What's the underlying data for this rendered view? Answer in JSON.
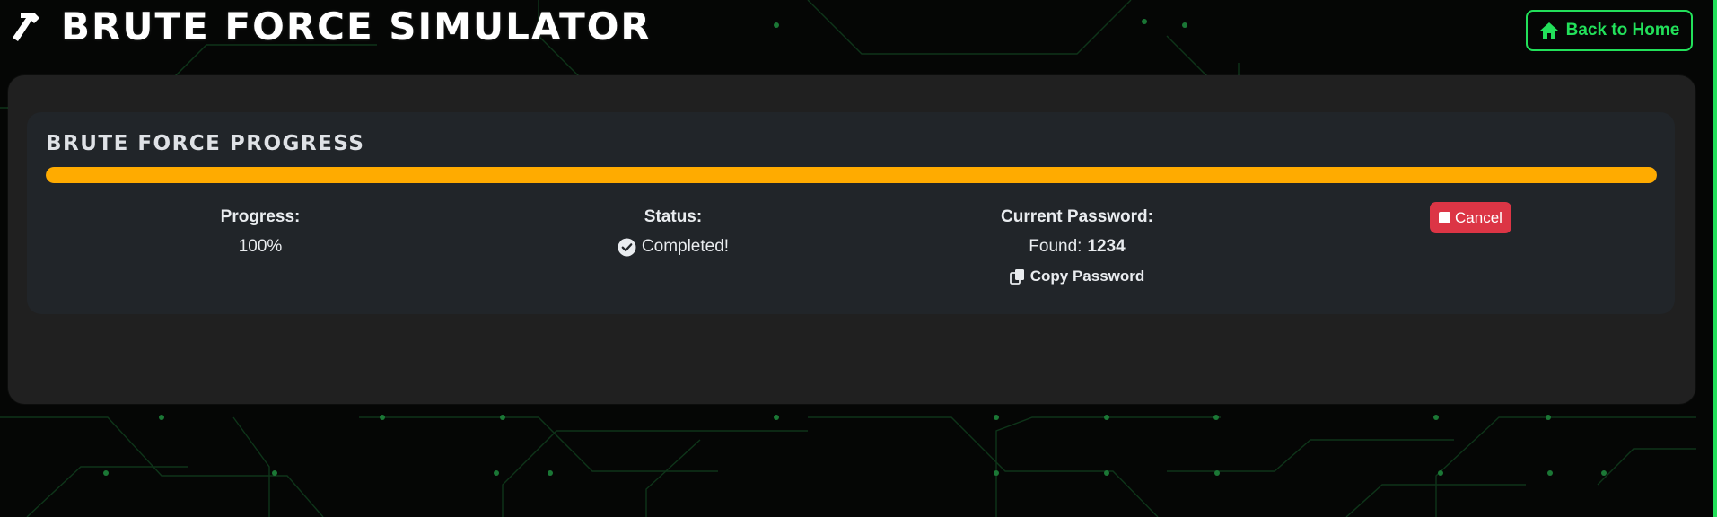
{
  "header": {
    "title": "BRUTE FORCE SIMULATOR",
    "logo_icon": "hammer-icon",
    "home_button": {
      "label": "Back to Home",
      "icon": "home-icon"
    }
  },
  "panel": {
    "title": "BRUTE FORCE PROGRESS",
    "progress": {
      "fraction": 1.0,
      "label": "Progress:",
      "value": "100%"
    },
    "status": {
      "label": "Status:",
      "icon": "check-circle-icon",
      "value": "Completed!"
    },
    "current_password": {
      "label": "Current Password:",
      "found_prefix": "Found:",
      "found_value": "1234",
      "copy_label": "Copy Password",
      "copy_icon": "copy-icon"
    },
    "cancel": {
      "label": "Cancel",
      "icon": "stop-icon"
    }
  },
  "colors": {
    "accent": "#22e05a",
    "progress_fill": "#ffab00",
    "cancel": "#dc3545",
    "card": "#212529",
    "background": "#050605"
  }
}
